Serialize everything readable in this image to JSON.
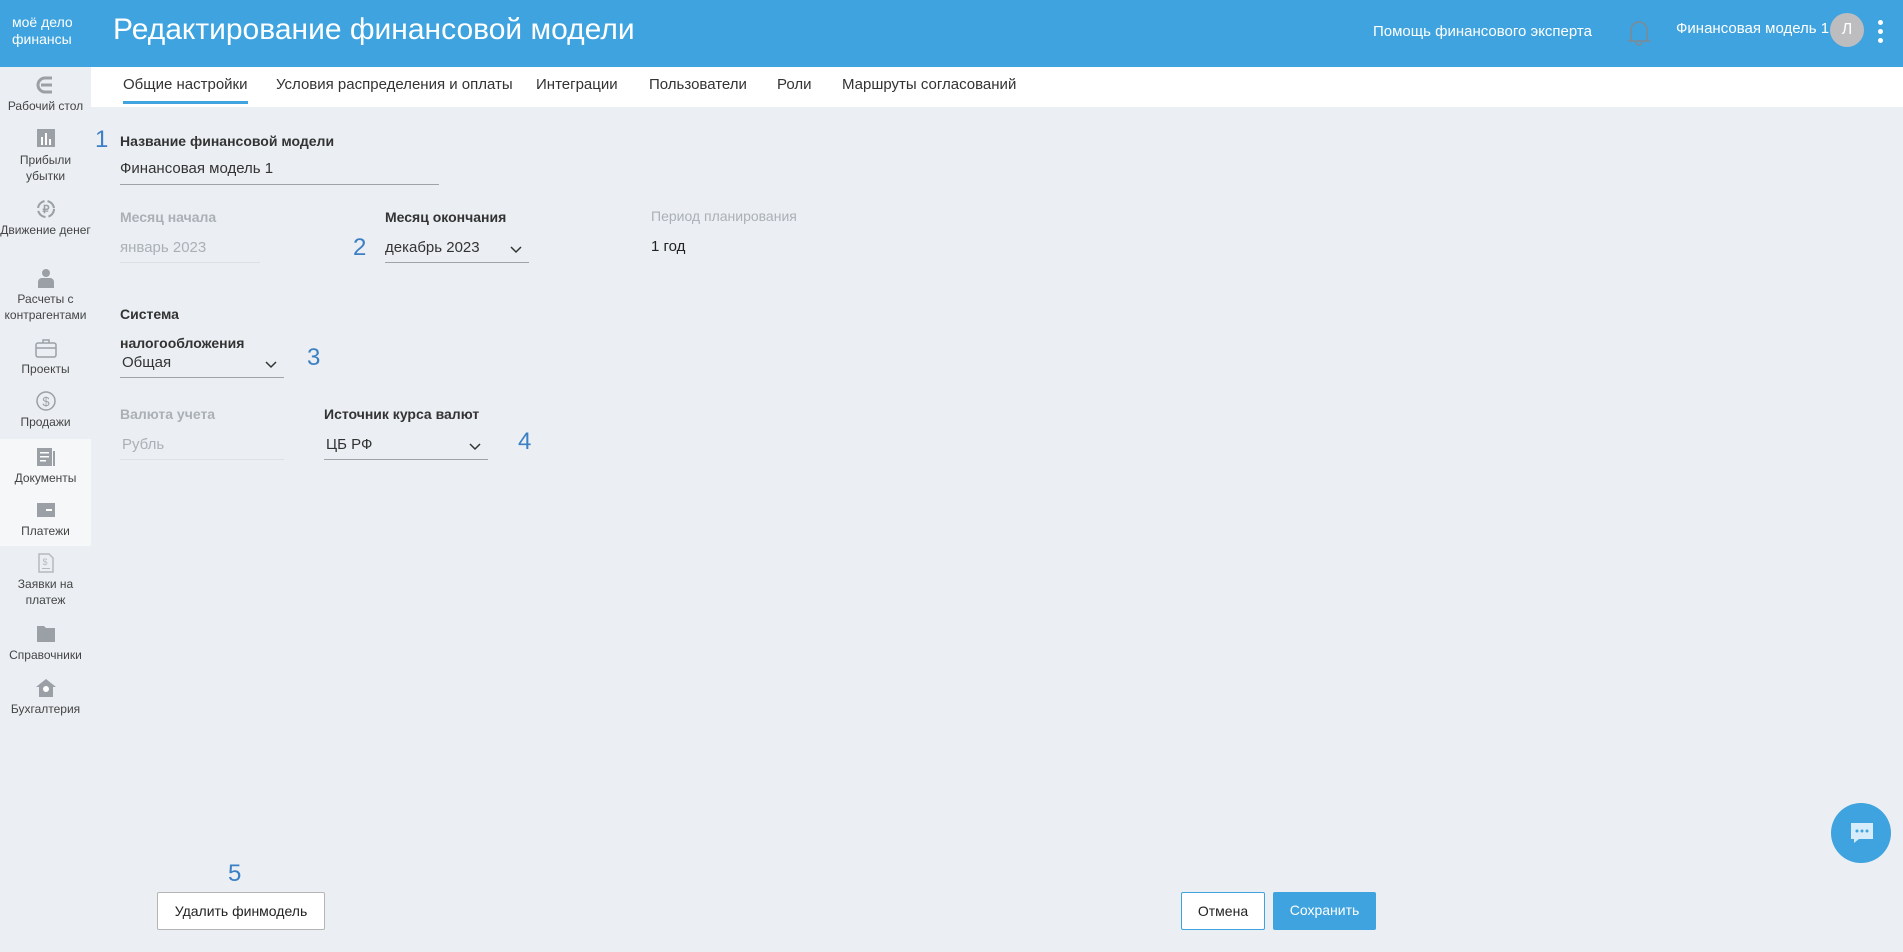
{
  "header": {
    "logo": [
      "моё дело",
      "финансы"
    ],
    "title": "Редактирование финансовой модели",
    "help": "Помощь финансового эксперта",
    "model_name": "Финансовая модель 1",
    "avatar_letter": "Л"
  },
  "tabs": [
    "Общие настройки",
    "Условия распределения и оплаты",
    "Интеграции",
    "Пользователи",
    "Роли",
    "Маршруты согласований"
  ],
  "sidebar": [
    {
      "label": "Рабочий стол",
      "icon": "desktop-icon"
    },
    {
      "label": "Прибыли убытки",
      "icon": "chart-icon"
    },
    {
      "label": "Движение денег",
      "icon": "ruble-cycle-icon"
    },
    {
      "label": "Расчеты с контрагентами",
      "icon": "person-icon"
    },
    {
      "label": "Проекты",
      "icon": "briefcase-icon"
    },
    {
      "label": "Продажи",
      "icon": "dollar-icon"
    },
    {
      "label": "Документы",
      "icon": "document-icon"
    },
    {
      "label": "Платежи",
      "icon": "wallet-icon"
    },
    {
      "label": "Заявки на платеж",
      "icon": "invoice-icon"
    },
    {
      "label": "Справочники",
      "icon": "folder-icon"
    },
    {
      "label": "Бухгалтерия",
      "icon": "house-icon"
    }
  ],
  "form": {
    "name_label": "Название финансовой модели",
    "name_value": "Финансовая модель 1",
    "start_label": "Месяц начала",
    "start_value": "январь 2023",
    "end_label": "Месяц окончания",
    "end_value": "декабрь 2023",
    "period_label": "Период планирования",
    "period_value": "1 год",
    "tax_label_1": "Система",
    "tax_label_2": "налогообложения",
    "tax_value": "Общая",
    "currency_label": "Валюта учета",
    "currency_value": "Рубль",
    "rate_label": "Источник курса валют",
    "rate_value": "ЦБ РФ"
  },
  "markers": [
    "1",
    "2",
    "3",
    "4",
    "5"
  ],
  "buttons": {
    "delete": "Удалить финмодель",
    "cancel": "Отмена",
    "save": "Сохранить"
  },
  "colors": {
    "accent": "#3ea3de",
    "marker": "#3b7fc4",
    "background": "#ebeff3"
  }
}
